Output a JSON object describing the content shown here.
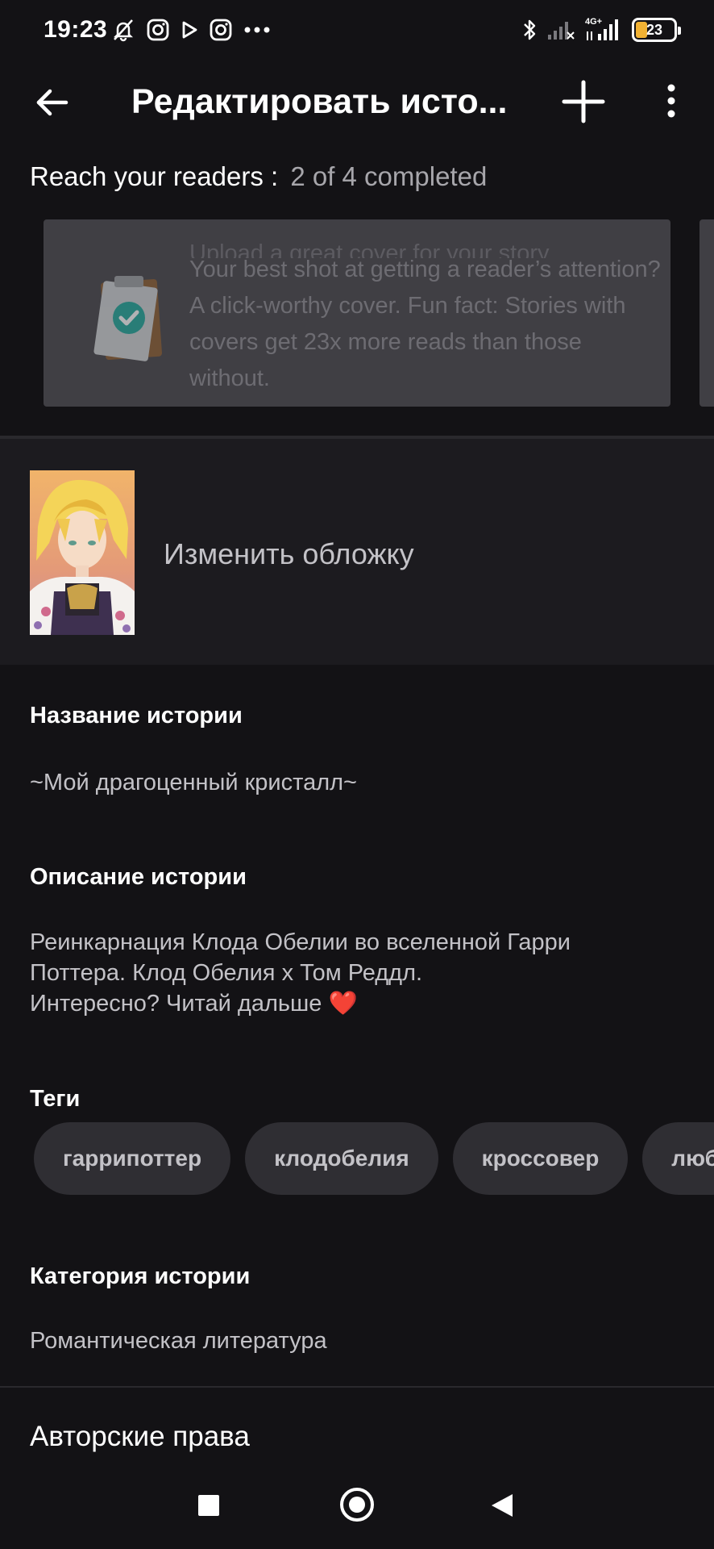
{
  "status_bar": {
    "time": "19:23",
    "network": "4G+",
    "battery": "23",
    "icons": [
      "mute-bell-icon",
      "instagram-icon",
      "play-icon",
      "instagram-icon",
      "more-dots-icon",
      "bluetooth-icon",
      "signal-empty-icon",
      "signal-4g-icon",
      "battery-icon"
    ]
  },
  "app_bar": {
    "title": "Редактировать исто...",
    "back_icon": "arrow-left-icon",
    "add_icon": "plus-icon",
    "more_icon": "more-vertical-icon"
  },
  "reach": {
    "label": "Reach your readers :",
    "progress": "2 of 4 completed"
  },
  "card": {
    "title": "Upload a great cover for your story",
    "body": "Your best shot at getting a reader’s attention? A click-worthy cover. Fun fact: Stories with covers get 23x more reads than those without.",
    "icon": "clipboard-check-icon"
  },
  "cover": {
    "label": "Изменить обложку"
  },
  "story_title": {
    "label": "Название истории",
    "value": "~Мой драгоценный кристалл~"
  },
  "description": {
    "label": "Описание истории",
    "lines": [
      "Реинкарнация Клода Обелии во вселенной Гарри",
      "Поттера. Клод Обелия х Том Реддл.",
      "Интересно? Читай дальше"
    ],
    "heart": "❤️"
  },
  "tags": {
    "label": "Теги",
    "items": [
      "гаррипоттер",
      "клодобелия",
      "кроссовер",
      "люб"
    ]
  },
  "category": {
    "label": "Категория истории",
    "value": "Романтическая литература"
  },
  "copyright": {
    "label": "Авторские права"
  },
  "colors": {
    "background": "#131215",
    "surface": "#1c1b1f",
    "card": "#403f44",
    "tag": "#2f2e33",
    "accent_teal": "#1aa79a",
    "battery": "#f2b233"
  }
}
